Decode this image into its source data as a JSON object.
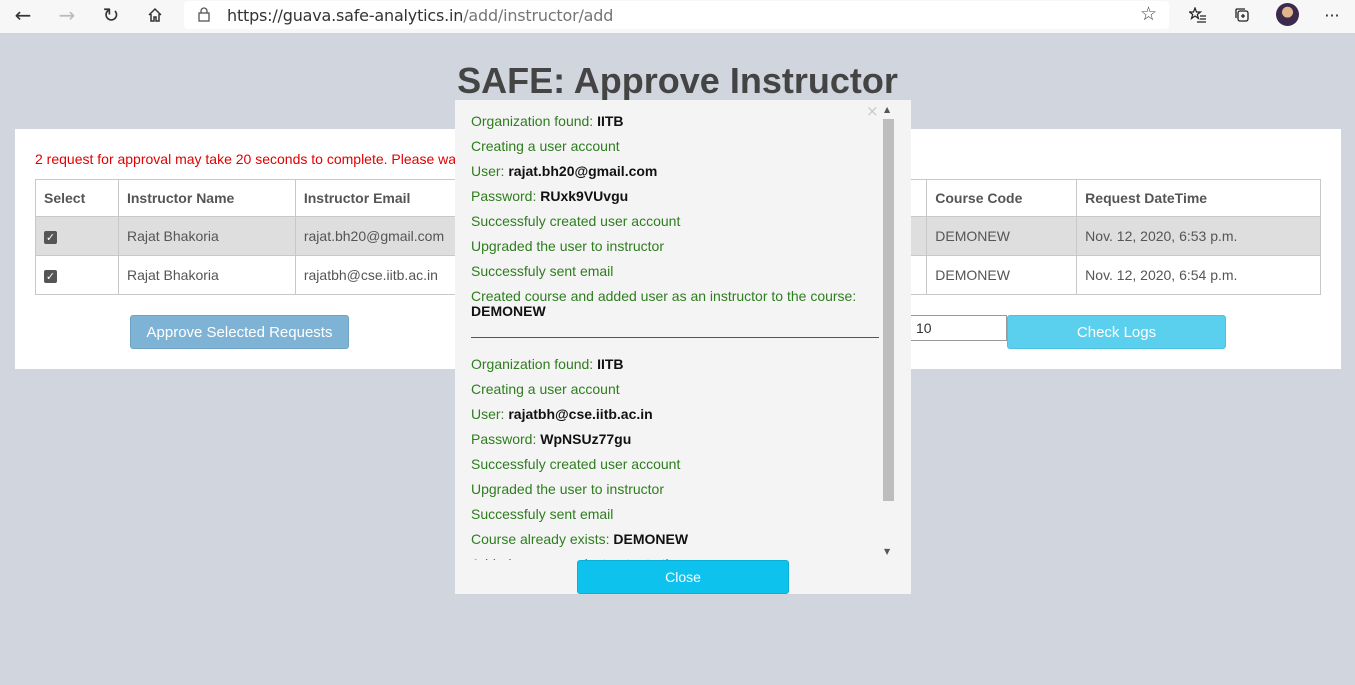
{
  "browser": {
    "url_host": "https://guava.safe-analytics.in",
    "url_path": "/add/instructor/add",
    "icons": [
      "back-arrow-icon",
      "forward-arrow-icon",
      "refresh-icon",
      "home-icon",
      "lock-icon",
      "star-icon",
      "favorites-icon",
      "collections-icon",
      "avatar",
      "more-icon"
    ]
  },
  "page": {
    "title": "SAFE: Approve Instructor",
    "notice": "2 request for approval may take 20 seconds to complete. Please wa"
  },
  "table": {
    "headers": [
      "Select",
      "Instructor Name",
      "Instructor Email",
      "Course Code",
      "Request DateTime"
    ],
    "rows": [
      {
        "name": "Rajat Bhakoria",
        "email": "rajat.bh20@gmail.com",
        "course": "DEMONEW",
        "datetime": "Nov. 12, 2020, 6:53 p.m."
      },
      {
        "name": "Rajat Bhakoria",
        "email": "rajatbh@cse.iitb.ac.in",
        "course": "DEMONEW",
        "datetime": "Nov. 12, 2020, 6:54 p.m."
      }
    ]
  },
  "controls": {
    "approve_label": "Approve Selected Requests",
    "count_value": "10",
    "check_logs_label": "Check Logs"
  },
  "modal": {
    "close_x": "×",
    "close_label": "Close",
    "block1": {
      "org_label": "Organization found: ",
      "org_value": "IITB",
      "creating": "Creating a user account",
      "user_label": "User: ",
      "user_value": "rajat.bh20@gmail.com",
      "pw_label": "Password: ",
      "pw_value": "RUxk9VUvgu",
      "created": "Successfuly created user account",
      "upgraded": "Upgraded the user to instructor",
      "sent": "Successfuly sent email",
      "course_label": "Created course and added user as an instructor to the course: ",
      "course_value": "DEMONEW"
    },
    "block2": {
      "org_label": "Organization found: ",
      "org_value": "IITB",
      "creating": "Creating a user account",
      "user_label": "User: ",
      "user_value": "rajatbh@cse.iitb.ac.in",
      "pw_label": "Password: ",
      "pw_value": "WpNSUz77gu",
      "created": "Successfuly created user account",
      "upgraded": "Upgraded the user to instructor",
      "sent": "Successfuly sent email",
      "course_label": "Course already exists: ",
      "course_value": "DEMONEW",
      "partial": "Added user as an instructor to the course"
    }
  },
  "colors": {
    "page_bg": "#d1d5dd",
    "notice_red": "#e00000",
    "log_green": "#2e7d1e",
    "approve_btn": "#7fb3d5",
    "logs_btn": "#5bd0ee",
    "close_btn": "#0dc3ee"
  }
}
